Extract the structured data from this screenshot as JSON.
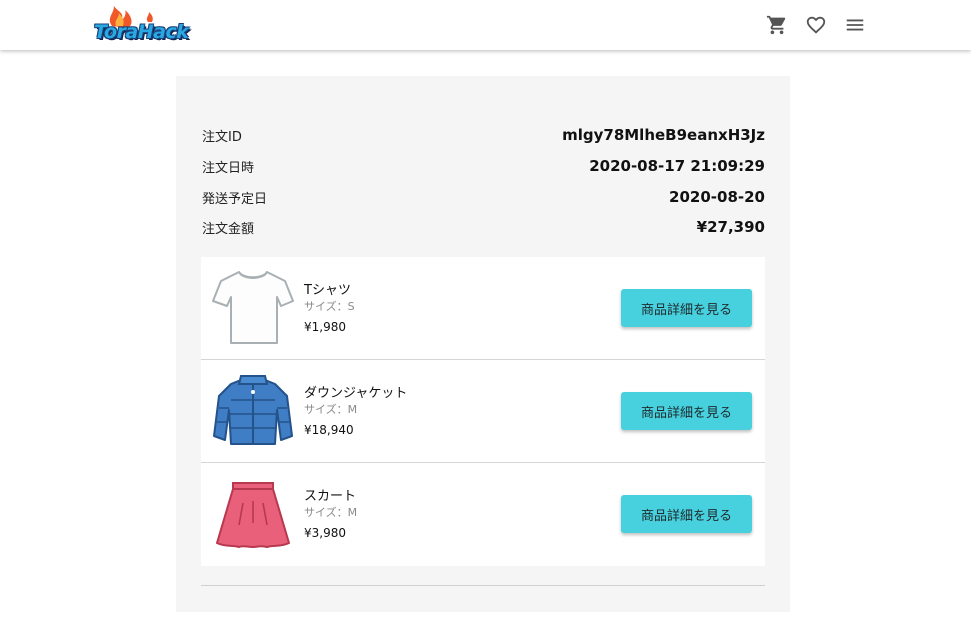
{
  "header": {
    "logo_text": "ToraHack",
    "icons": [
      "cart-icon",
      "heart-icon",
      "menu-icon"
    ]
  },
  "order": {
    "rows": [
      {
        "label": "注文ID",
        "value": "mlgy78MlheB9eanxH3Jz"
      },
      {
        "label": "注文日時",
        "value": "2020-08-17 21:09:29"
      },
      {
        "label": "発送予定日",
        "value": "2020-08-20"
      },
      {
        "label": "注文金額",
        "value": "¥27,390"
      }
    ]
  },
  "items": [
    {
      "name": "Tシャツ",
      "size": "サイズ：S",
      "price": "¥1,980",
      "button": "商品詳細を見る",
      "image": "tshirt-image"
    },
    {
      "name": "ダウンジャケット",
      "size": "サイズ：M",
      "price": "¥18,940",
      "button": "商品詳細を見る",
      "image": "down-jacket-image"
    },
    {
      "name": "スカート",
      "size": "サイズ：M",
      "price": "¥3,980",
      "button": "商品詳細を見る",
      "image": "skirt-image"
    }
  ],
  "colors": {
    "accent": "#47d0de",
    "panel_bg": "#f5f5f5",
    "logo_blue": "#29a9e1",
    "flame": "#f0582a"
  }
}
